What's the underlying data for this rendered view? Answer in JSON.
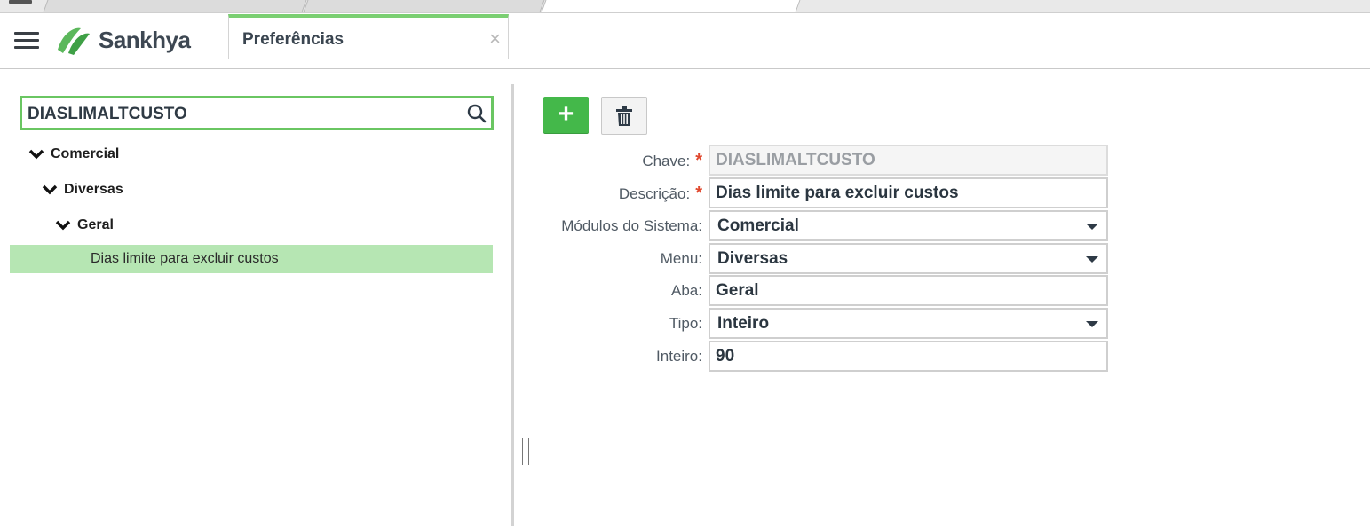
{
  "app": {
    "brand": "Sankhya",
    "open_tab": {
      "label": "Preferências",
      "close_symbol": "×"
    }
  },
  "left_panel": {
    "search": {
      "value": "DIASLIMALTCUSTO"
    },
    "tree": [
      {
        "label": "Comercial",
        "expanded": true
      },
      {
        "label": "Diversas",
        "expanded": true
      },
      {
        "label": "Geral",
        "expanded": true
      }
    ],
    "selected_leaf": {
      "label": "Dias limite para excluir custos"
    }
  },
  "toolbar": {
    "add_symbol": "+",
    "add_icon": "plus-icon",
    "delete_icon": "trash-icon"
  },
  "form": {
    "required_marker": "*",
    "fields": [
      {
        "label": "Chave:",
        "value": "DIASLIMALTCUSTO",
        "required": true,
        "readonly": true,
        "type": "text"
      },
      {
        "label": "Descrição:",
        "value": "Dias limite para excluir custos",
        "required": true,
        "readonly": false,
        "type": "text"
      },
      {
        "label": "Módulos do Sistema:",
        "value": "Comercial",
        "required": false,
        "type": "select"
      },
      {
        "label": "Menu:",
        "value": "Diversas",
        "required": false,
        "type": "select"
      },
      {
        "label": "Aba:",
        "value": "Geral",
        "required": false,
        "type": "text"
      },
      {
        "label": "Tipo:",
        "value": "Inteiro",
        "required": false,
        "type": "select"
      },
      {
        "label": "Inteiro:",
        "value": "90",
        "required": false,
        "type": "text"
      }
    ]
  },
  "colors": {
    "accent_green": "#44b84a",
    "selection_green": "#b6e6b3",
    "search_border": "#6ac662",
    "required": "#e0472d"
  }
}
